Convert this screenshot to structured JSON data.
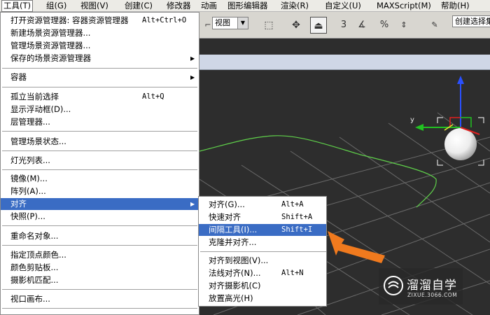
{
  "menubar": {
    "items": [
      "工具(T)",
      "组(G)",
      "视图(V)",
      "创建(C)",
      "修改器",
      "动画",
      "图形编辑器",
      "渲染(R)",
      "自定义(U)",
      "MAXScript(M)",
      "帮助(H)"
    ]
  },
  "toolbar": {
    "view_select": "视图",
    "create_selection": "创建选择集",
    "icons": [
      "select-object-icon",
      "move-icon",
      "align-icon",
      "snap-3-icon",
      "angle-snap-icon",
      "percent-snap-icon",
      "spinner-snap-icon",
      "edit-named-selection-icon"
    ]
  },
  "main_menu": {
    "items": [
      {
        "label": "打开资源管理器: 容器资源管理器",
        "shortcut": "Alt+Ctrl+O"
      },
      {
        "label": "新建场景资源管理器...",
        "shortcut": ""
      },
      {
        "label": "管理场景资源管理器...",
        "shortcut": ""
      },
      {
        "label": "保存的场景资源管理器",
        "shortcut": "",
        "submenu": true
      },
      {
        "label": "容器",
        "shortcut": "",
        "submenu": true
      },
      {
        "label": "孤立当前选择",
        "shortcut": "Alt+Q"
      },
      {
        "label": "显示浮动框(D)...",
        "shortcut": ""
      },
      {
        "label": "层管理器...",
        "shortcut": ""
      },
      {
        "label": "管理场景状态...",
        "shortcut": ""
      },
      {
        "label": "灯光列表...",
        "shortcut": ""
      },
      {
        "label": "镜像(M)...",
        "shortcut": ""
      },
      {
        "label": "阵列(A)...",
        "shortcut": ""
      },
      {
        "label": "对齐",
        "shortcut": "",
        "submenu": true,
        "highlighted": true
      },
      {
        "label": "快照(P)...",
        "shortcut": ""
      },
      {
        "label": "重命名对象...",
        "shortcut": ""
      },
      {
        "label": "指定顶点颜色...",
        "shortcut": ""
      },
      {
        "label": "颜色剪贴板...",
        "shortcut": ""
      },
      {
        "label": "摄影机匹配...",
        "shortcut": ""
      },
      {
        "label": "视口画布...",
        "shortcut": ""
      }
    ]
  },
  "submenu": {
    "items": [
      {
        "label": "对齐(G)...",
        "shortcut": "Alt+A"
      },
      {
        "label": "快速对齐",
        "shortcut": "Shift+A"
      },
      {
        "label": "间隔工具(I)...",
        "shortcut": "Shift+I",
        "highlighted": true
      },
      {
        "label": "克隆并对齐...",
        "shortcut": ""
      },
      {
        "label": "对齐到视图(V)...",
        "shortcut": ""
      },
      {
        "label": "法线对齐(N)...",
        "shortcut": "Alt+N"
      },
      {
        "label": "对齐摄影机(C)",
        "shortcut": ""
      },
      {
        "label": "放置高光(H)",
        "shortcut": ""
      }
    ]
  },
  "viewport": {
    "axis_label": "y"
  },
  "watermark": {
    "title": "溜溜自学",
    "url": "ZIXUE.3066.COM"
  },
  "colors": {
    "highlight": "#3a6cc4",
    "annotation_arrow": "#f07a1e",
    "spline": "#5fd04a",
    "gizmo_y": "#22c222",
    "gizmo_z": "#2a50ff",
    "gizmo_x": "#e02020"
  }
}
